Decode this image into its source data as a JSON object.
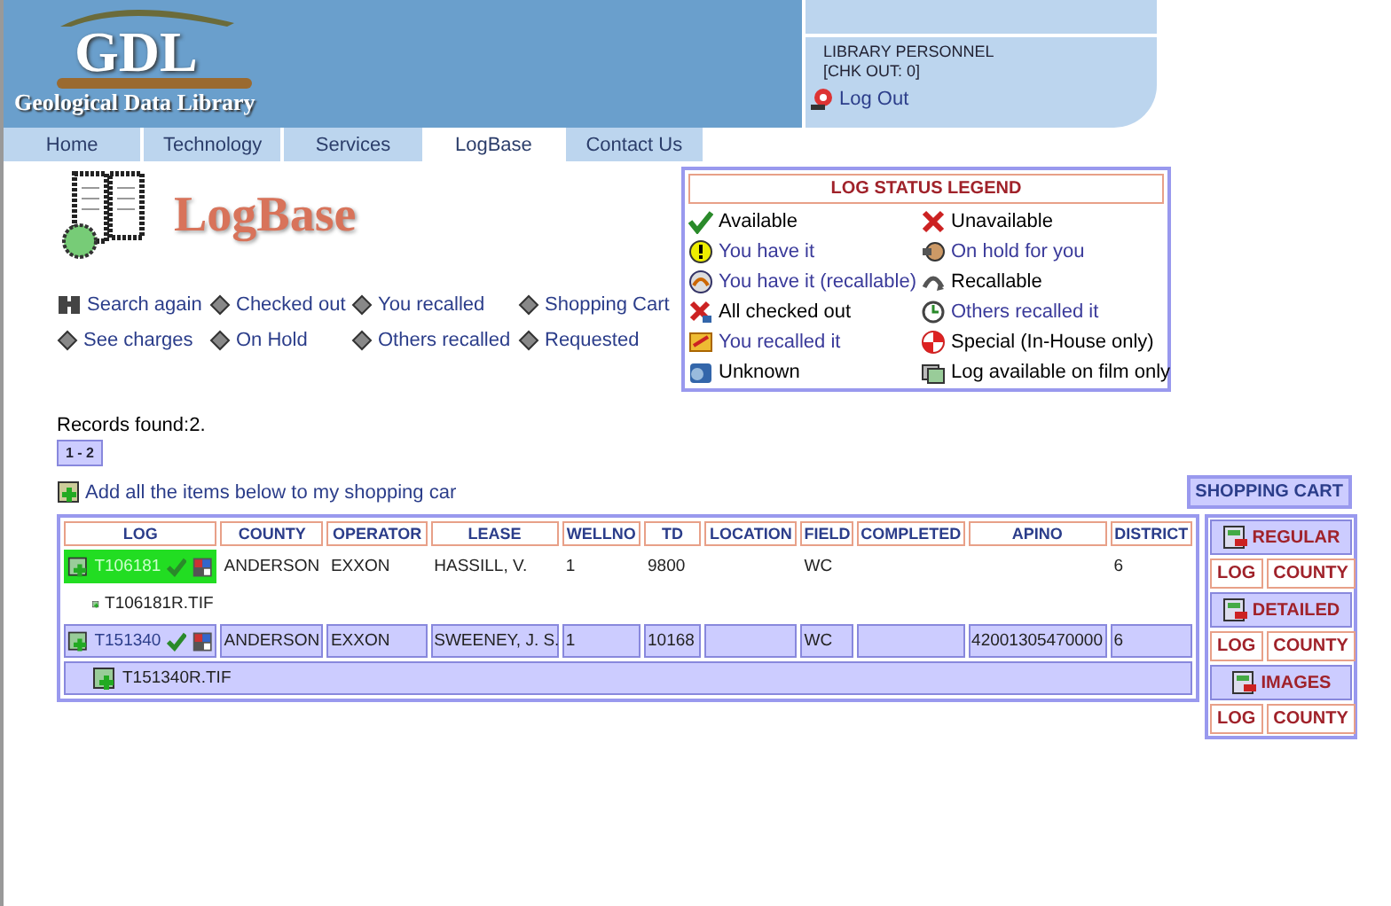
{
  "header": {
    "logo_title": "GDL",
    "logo_subtitle": "Geological Data Library"
  },
  "user_panel": {
    "name": "LIBRARY PERSONNEL",
    "checkout": "[CHK OUT: 0]",
    "logout": "Log Out"
  },
  "tabs": [
    {
      "label": "Home",
      "selected": false
    },
    {
      "label": "Technology",
      "selected": false
    },
    {
      "label": "Services",
      "selected": false
    },
    {
      "label": "LogBase",
      "selected": true
    },
    {
      "label": "Contact Us",
      "selected": false
    }
  ],
  "page_title": "LogBase",
  "links": [
    {
      "label": "Search again",
      "kind": "search"
    },
    {
      "label": "Checked out",
      "kind": "diamond"
    },
    {
      "label": "You recalled",
      "kind": "diamond"
    },
    {
      "label": "Shopping Cart",
      "kind": "diamond"
    },
    {
      "label": "See charges",
      "kind": "diamond"
    },
    {
      "label": "On Hold",
      "kind": "diamond"
    },
    {
      "label": "Others recalled",
      "kind": "diamond"
    },
    {
      "label": "Requested",
      "kind": "diamond"
    }
  ],
  "legend": {
    "title": "LOG STATUS LEGEND",
    "items": [
      {
        "label": "Available",
        "kind": "check",
        "color": "#000000"
      },
      {
        "label": "Unavailable",
        "kind": "cross",
        "color": "#000000"
      },
      {
        "label": "You have it",
        "kind": "alert",
        "color": "#3a3a9a"
      },
      {
        "label": "On hold for you",
        "kind": "hold",
        "color": "#3a3a9a"
      },
      {
        "label": "You have it (recallable)",
        "kind": "own-recall",
        "color": "#3a3a9a"
      },
      {
        "label": "Recallable",
        "kind": "recall",
        "color": "#000000"
      },
      {
        "label": "All checked out",
        "kind": "all-out",
        "color": "#000000"
      },
      {
        "label": "Others recalled it",
        "kind": "clock",
        "color": "#3a3a9a"
      },
      {
        "label": "You recalled it",
        "kind": "you-recalled",
        "color": "#3a3a9a"
      },
      {
        "label": "Special (In-House only)",
        "kind": "special",
        "color": "#000000"
      },
      {
        "label": "Unknown",
        "kind": "unknown",
        "color": "#000000"
      },
      {
        "label": "Log available on film only",
        "kind": "film",
        "color": "#000000"
      }
    ]
  },
  "records_found": "Records found:2.",
  "pager": "1 - 2",
  "add_all": "Add all the items below to my shopping car",
  "table": {
    "columns": [
      "LOG",
      "COUNTY",
      "OPERATOR",
      "LEASE",
      "WELLNO",
      "TD",
      "LOCATION",
      "FIELD",
      "COMPLETED",
      "APINO",
      "DISTRICT"
    ],
    "rows": [
      {
        "log": "T106181",
        "selected": true,
        "cells": {
          "COUNTY": "ANDERSON",
          "OPERATOR": "EXXON",
          "LEASE": "HASSILL, V.",
          "WELLNO": "1",
          "TD": "9800",
          "FIELD": "WC",
          "DISTRICT": "6"
        },
        "file": "T106181R.TIF"
      },
      {
        "log": "T151340",
        "selected": false,
        "cells": {
          "COUNTY": "ANDERSON",
          "OPERATOR": "EXXON",
          "LEASE": "SWEENEY, J. S.",
          "WELLNO": "1",
          "TD": "10168",
          "FIELD": "WC",
          "APINO": "42001305470000",
          "DISTRICT": "6"
        },
        "file": "T151340R.TIF"
      }
    ]
  },
  "side_panel": {
    "cart": "SHOPPING CART",
    "sections": [
      {
        "title": "REGULAR",
        "buttons": [
          "LOG",
          "COUNTY"
        ]
      },
      {
        "title": "DETAILED",
        "buttons": [
          "LOG",
          "COUNTY"
        ]
      },
      {
        "title": "IMAGES",
        "buttons": [
          "LOG",
          "COUNTY"
        ]
      }
    ]
  }
}
